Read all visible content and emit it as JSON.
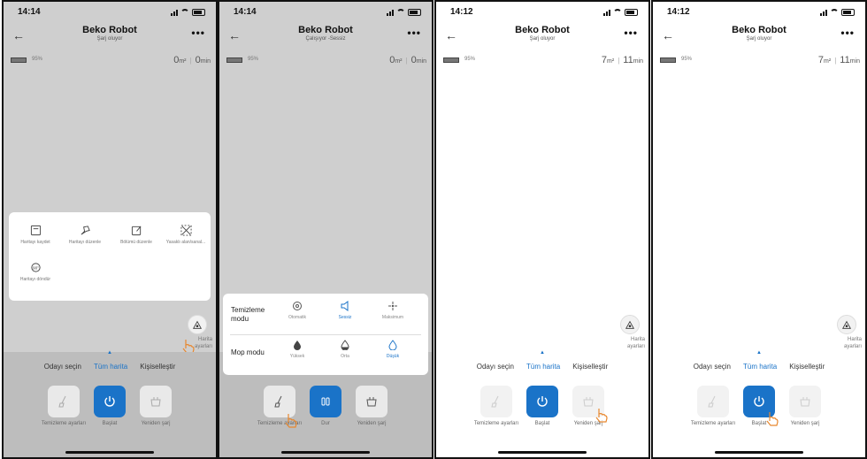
{
  "screens": [
    {
      "time": "14:14",
      "title": "Beko Robot",
      "subtitle": "Şarj oluyor",
      "battery": "95%",
      "area_value": "0",
      "area_unit": "m²",
      "time_value": "0",
      "time_unit": "min"
    },
    {
      "time": "14:14",
      "title": "Beko Robot",
      "subtitle": "Çalışıyor -Sessiz",
      "battery": "95%",
      "area_value": "0",
      "area_unit": "m²",
      "time_value": "0",
      "time_unit": "min"
    },
    {
      "time": "14:12",
      "title": "Beko Robot",
      "subtitle": "Şarj oluyor",
      "battery": "95%",
      "area_value": "7",
      "area_unit": "m²",
      "time_value": "11",
      "time_unit": "min"
    },
    {
      "time": "14:12",
      "title": "Beko Robot",
      "subtitle": "Şarj oluyor",
      "battery": "95%",
      "area_value": "7",
      "area_unit": "m²",
      "time_value": "11",
      "time_unit": "min"
    }
  ],
  "map_settings_label": "Harita ayarları",
  "tabs": {
    "select_room": "Odayı seçin",
    "full_map": "Tüm harita",
    "customize": "Kişiselleştir"
  },
  "controls": {
    "cleaning_settings": "Temizleme ayarları",
    "start": "Başlat",
    "pause": "Dur",
    "recharge": "Yeniden şarj"
  },
  "map_menu": {
    "save_map": "Haritayı kaydet",
    "edit_map": "Haritayı düzenle",
    "edit_partition": "Bölümü düzenle",
    "no_go": "Yasaklı alan/sanal...",
    "rotate_map": "Haritayı döndür"
  },
  "cleaning_panel": {
    "cleaning_mode_label": "Temizleme modu",
    "mop_mode_label": "Mop modu",
    "cleaning_modes": [
      "Otomatik",
      "Sessiz",
      "Maksimum"
    ],
    "mop_modes": [
      "Yüksek",
      "Orta",
      "Düşük"
    ]
  },
  "colors": {
    "accent": "#1a73c8",
    "overlay": "#cfcfcf"
  }
}
